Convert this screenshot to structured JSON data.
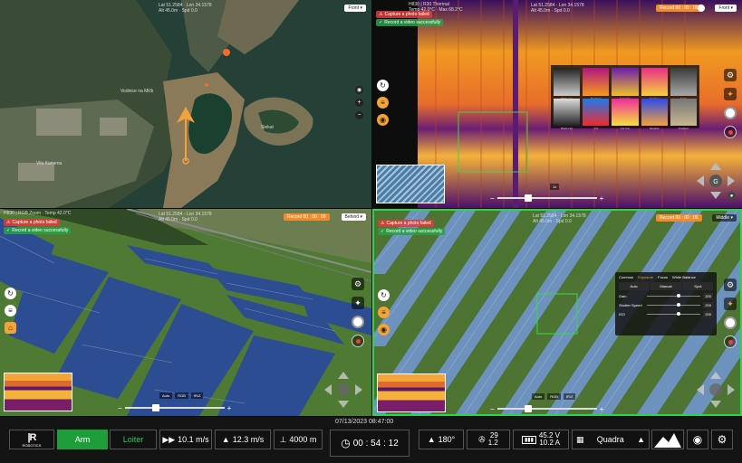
{
  "map_pane": {
    "camera_label": "Front",
    "place_village": "Vodnice na Mlčk",
    "place_island": "Siekat",
    "place_road": "Vila Kamena"
  },
  "thermal_pane": {
    "header": "H830 | R30 Thermal",
    "camera_label": "Front",
    "record_label": "Record",
    "record_time": "00 : 00 : 00",
    "alert_fail": "Capture a photo failed",
    "alert_ok": "Record a video successfully",
    "palettes": [
      "White Hot",
      "Rainbow",
      "Fulgurite",
      "Ironbow",
      "Arctic",
      "Black Hot",
      "Tint",
      "Hot Iron",
      "Medical",
      "Gradient"
    ],
    "zoom_value": "1x"
  },
  "rgb_pane": {
    "camera_label": "Behind",
    "record_label": "Record",
    "record_time": "00 : 00 : 00",
    "alert_fail": "Capture a photo failed",
    "alert_ok": "Record a video successfully",
    "zoom_labels": [
      "Auto",
      "RGB",
      "IR/Z"
    ]
  },
  "main_pane": {
    "camera_label": "Middle",
    "record_label": "Record",
    "record_time": "00 : 00 : 00",
    "alert_fail": "Capture a photo failed",
    "alert_ok": "Record a video successfully",
    "settings": {
      "tabs": [
        "Common",
        "Exposure",
        "Focus",
        "White Balance"
      ],
      "modes": [
        "Auto",
        "Manual",
        "Spot"
      ],
      "rows": [
        {
          "label": "Gain",
          "value": "200"
        },
        {
          "label": "Shutter Speed",
          "value": "200"
        },
        {
          "label": "ISO",
          "value": "200"
        }
      ]
    },
    "zoom_labels": [
      "Auto",
      "RGB",
      "IR/Z"
    ]
  },
  "bottom_bar": {
    "datetime": "07/13/2023 08:47:00",
    "logo_sub": "ROBOTICS",
    "arm_label": "Arm",
    "loiter_label": "Loiter",
    "horizontal_speed": "10.1 m/s",
    "vertical_speed": "12.3 m/s",
    "altitude": "4000 m",
    "timer": "00 : 54 : 12",
    "heading": "180°",
    "satellites": "29",
    "hdop": "1.2",
    "voltage": "45.2 V",
    "current": "10.2 A",
    "layout_label": "Quadra"
  },
  "colors": {
    "accent_green": "#29d84a",
    "record_orange": "#f28b2b",
    "arm_green": "#1e9e3a"
  }
}
